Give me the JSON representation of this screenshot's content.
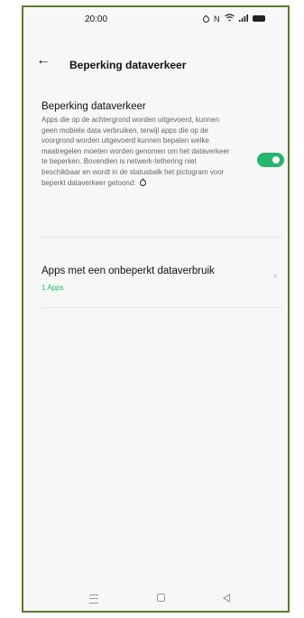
{
  "status_bar": {
    "time": "20:00",
    "icons": [
      "data-saver-icon",
      "nfc-icon",
      "wifi-icon",
      "signal-icon",
      "battery-icon"
    ]
  },
  "app_bar": {
    "title": "Beperking dataverkeer"
  },
  "data_saver": {
    "heading": "Beperking dataverkeer",
    "description": "Apps die op de achtergrond worden uitgevoerd, kunnen geen mobiele data verbruiken, terwijl apps die op de voorgrond worden uitgevoerd kunnen bepalen welke maatregelen moeten worden genomen om het dataverkeer te beperken. Bovendien is netwerk-tethering niet beschikbaar en wordt in de statusbalk het pictogram voor beperkt dataverkeer getoond:",
    "toggle_on": true
  },
  "unrestricted_apps": {
    "label": "Apps met een onbeperkt dataverbruik",
    "count_text": "1 Apps"
  },
  "colors": {
    "accent": "#27b56b",
    "frame_border": "#5a7d2a",
    "background": "#f7f7f7"
  }
}
